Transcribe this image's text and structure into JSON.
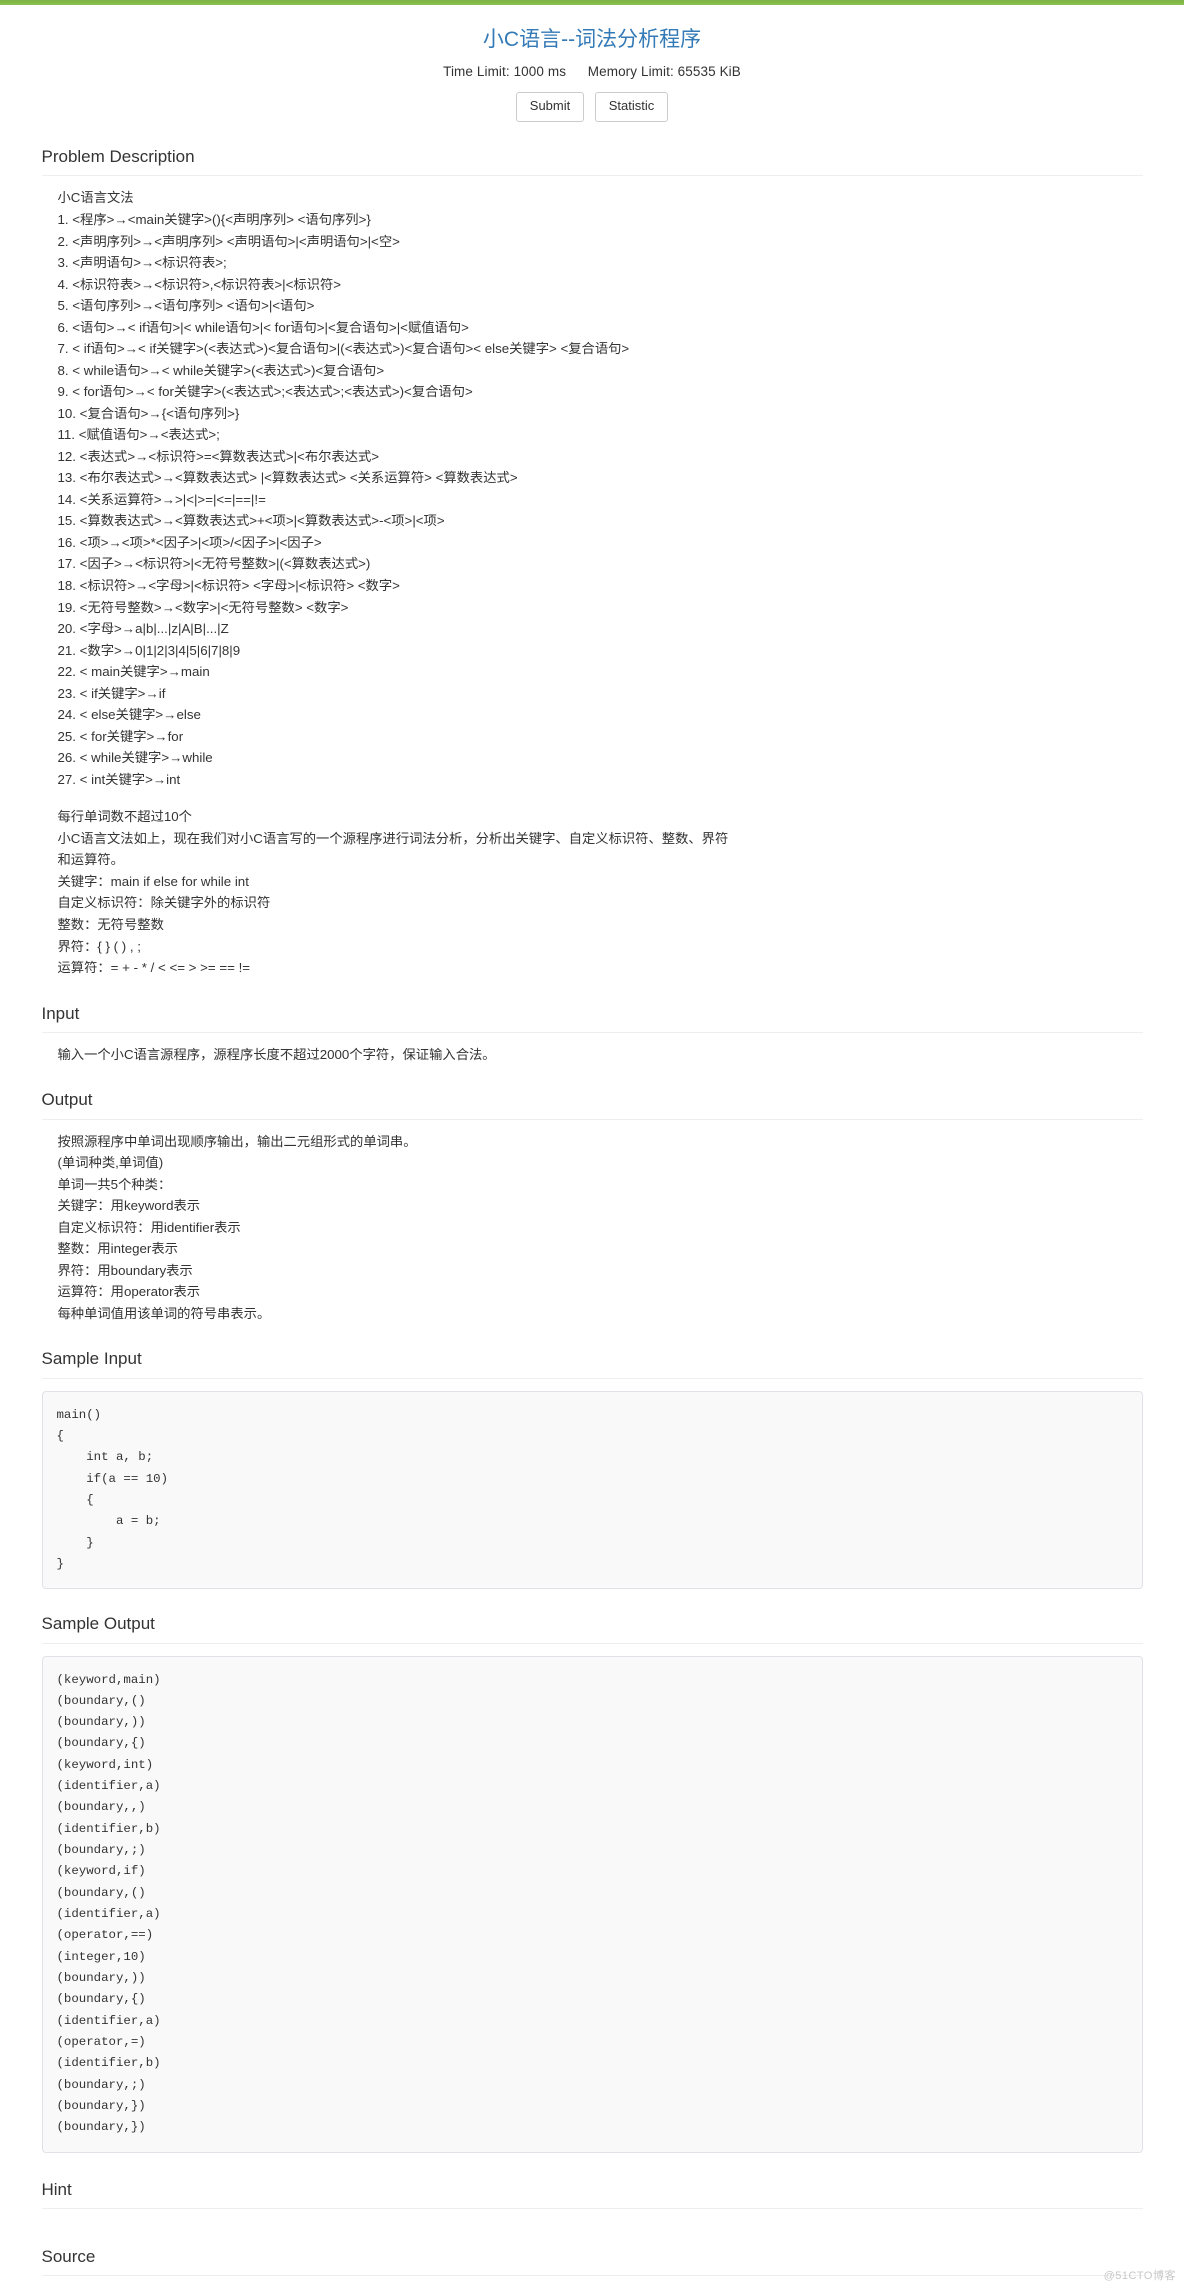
{
  "theme": {
    "accent_bar": "#8cc152",
    "title_color": "#337ab7",
    "bg": "#ffffff",
    "code_bg": "#f9f9f9"
  },
  "header": {
    "title": "小C语言--词法分析程序",
    "time_limit": "Time Limit: 1000 ms",
    "memory_limit": "Memory Limit: 65535 KiB",
    "buttons": [
      {
        "label": "Submit",
        "name": "submit-button"
      },
      {
        "label": "Statistic",
        "name": "statistic-button"
      }
    ]
  },
  "sections": {
    "problem_description": {
      "heading": "Problem Description",
      "lines": [
        "小C语言文法",
        "1. <程序>→<main关键字>(){<声明序列> <语句序列>}",
        "2. <声明序列>→<声明序列> <声明语句>|<声明语句>|<空>",
        "3. <声明语句>→<标识符表>;",
        "4. <标识符表>→<标识符>,<标识符表>|<标识符>",
        "5. <语句序列>→<语句序列> <语句>|<语句>",
        "6. <语句>→< if语句>|< while语句>|< for语句>|<复合语句>|<赋值语句>",
        "7. < if语句>→< if关键字>(<表达式>)<复合语句>|(<表达式>)<复合语句>< else关键字> <复合语句>",
        "8. < while语句>→< while关键字>(<表达式>)<复合语句>",
        "9. < for语句>→< for关键字>(<表达式>;<表达式>;<表达式>)<复合语句>",
        "10. <复合语句>→{<语句序列>}",
        "11. <赋值语句>→<表达式>;",
        "12. <表达式>→<标识符>=<算数表达式>|<布尔表达式>",
        "13. <布尔表达式>→<算数表达式> |<算数表达式> <关系运算符> <算数表达式>",
        "14. <关系运算符>→>|<|>=|<=|==|!=",
        "15. <算数表达式>→<算数表达式>+<项>|<算数表达式>-<项>|<项>",
        "16. <项>→<项>*<因子>|<项>/<因子>|<因子>",
        "17. <因子>→<标识符>|<无符号整数>|(<算数表达式>)",
        "18. <标识符>→<字母>|<标识符> <字母>|<标识符> <数字>",
        "19. <无符号整数>→<数字>|<无符号整数> <数字>",
        "20. <字母>→a|b|...|z|A|B|...|Z",
        "21. <数字>→0|1|2|3|4|5|6|7|8|9",
        "22. < main关键字>→main",
        "23. < if关键字>→if",
        "24. < else关键字>→else",
        "25. < for关键字>→for",
        "26. < while关键字>→while",
        "27. < int关键字>→int",
        "",
        "每行单词数不超过10个",
        "小C语言文法如上，现在我们对小C语言写的一个源程序进行词法分析，分析出关键字、自定义标识符、整数、界符",
        "和运算符。",
        "关键字：main if else for while int",
        "自定义标识符：除关键字外的标识符",
        "整数：无符号整数",
        "界符：{ } ( ) , ;",
        "运算符：= + - * / < <= > >= == !="
      ]
    },
    "input": {
      "heading": "Input",
      "lines": [
        "输入一个小C语言源程序，源程序长度不超过2000个字符，保证输入合法。"
      ]
    },
    "output": {
      "heading": "Output",
      "lines": [
        "按照源程序中单词出现顺序输出，输出二元组形式的单词串。",
        "(单词种类,单词值)",
        "单词一共5个种类：",
        "关键字：用keyword表示",
        "自定义标识符：用identifier表示",
        "整数：用integer表示",
        "界符：用boundary表示",
        "运算符：用operator表示",
        "每种单词值用该单词的符号串表示。"
      ]
    },
    "sample_input": {
      "heading": "Sample Input",
      "code": "main()\n{\n    int a, b;\n    if(a == 10)\n    {\n        a = b;\n    }\n}"
    },
    "sample_output": {
      "heading": "Sample Output",
      "code": "(keyword,main)\n(boundary,()\n(boundary,))\n(boundary,{)\n(keyword,int)\n(identifier,a)\n(boundary,,)\n(identifier,b)\n(boundary,;)\n(keyword,if)\n(boundary,()\n(identifier,a)\n(operator,==)\n(integer,10)\n(boundary,))\n(boundary,{)\n(identifier,a)\n(operator,=)\n(identifier,b)\n(boundary,;)\n(boundary,})\n(boundary,})"
    },
    "hint": {
      "heading": "Hint",
      "lines": []
    },
    "source": {
      "heading": "Source",
      "lines": []
    }
  },
  "watermark": "@51CTO博客"
}
